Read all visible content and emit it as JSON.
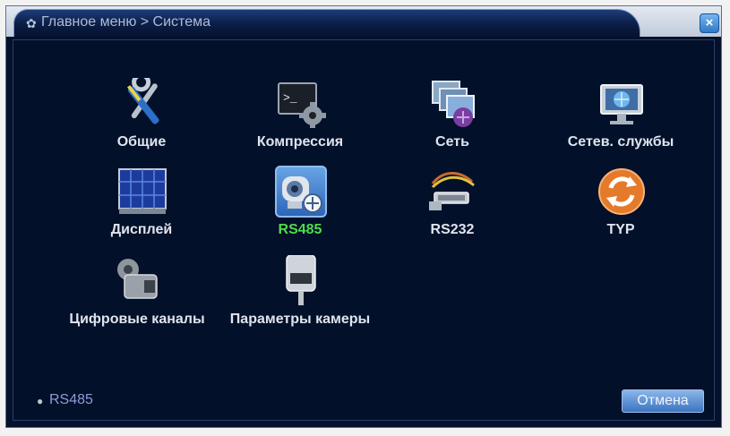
{
  "titlebar": {
    "title": "Главное меню > Система",
    "gear_icon": "gear-icon",
    "close_icon": "close-icon"
  },
  "items": [
    {
      "label": "Общие",
      "icon": "tools-icon",
      "selected": false
    },
    {
      "label": "Компрессия",
      "icon": "terminal-gear-icon",
      "selected": false
    },
    {
      "label": "Сеть",
      "icon": "network-icon",
      "selected": false
    },
    {
      "label": "Сетев. службы",
      "icon": "network-services-icon",
      "selected": false
    },
    {
      "label": "Дисплей",
      "icon": "display-icon",
      "selected": false
    },
    {
      "label": "RS485",
      "icon": "ptz-camera-icon",
      "selected": true
    },
    {
      "label": "RS232",
      "icon": "serial-cable-icon",
      "selected": false
    },
    {
      "label": "TYP",
      "icon": "tour-icon",
      "selected": false
    },
    {
      "label": "Цифровые каналы",
      "icon": "digital-channels-icon",
      "selected": false
    },
    {
      "label": "Параметры камеры",
      "icon": "camera-params-icon",
      "selected": false
    }
  ],
  "status": {
    "label": "RS485",
    "icon": "info-icon"
  },
  "footer": {
    "cancel_label": "Отмена"
  },
  "colors": {
    "background": "#03102a",
    "label": "#dfe5ee",
    "selected_label": "#4fdc4a",
    "status_text": "#8f9bd8",
    "button": "#3c74c2"
  }
}
